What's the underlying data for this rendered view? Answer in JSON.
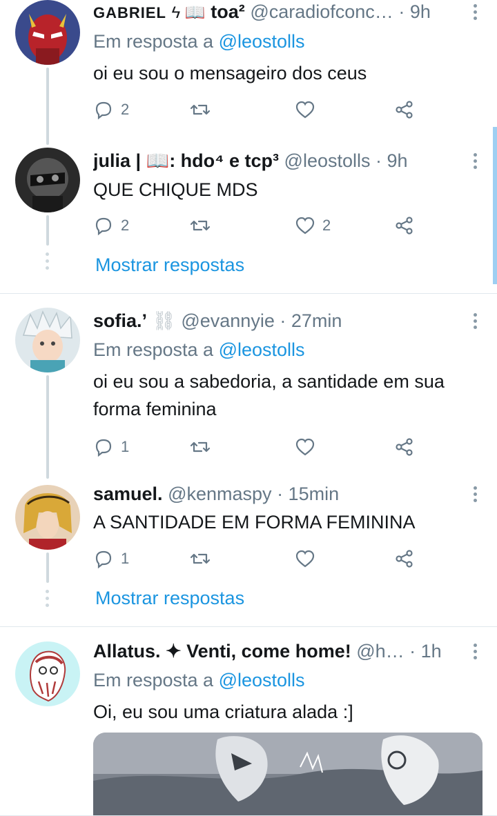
{
  "reply_prefix": "Em resposta a",
  "show_replies_label": "Mostrar respostas",
  "tweets": [
    {
      "name": "GABRIEL",
      "name_emoji": "ϟ 📖",
      "name_suffix": "toa²",
      "handle": "@caradiofconc…",
      "time": "· 9h",
      "reply_to": "@leostolls",
      "text": "oi eu sou o mensageiro dos ceus",
      "replies": "2",
      "retweets": "",
      "likes": ""
    },
    {
      "name": "julia | 📖: hdo⁴ e tcp³",
      "handle": "@leostolls",
      "time": "· 9h",
      "text": "QUE CHIQUE MDS",
      "replies": "2",
      "retweets": "",
      "likes": "2"
    },
    {
      "name": "sofia.’",
      "name_emoji": "⛓",
      "handle": "@evannyie",
      "time": "· 27min",
      "reply_to": "@leostolls",
      "text_line1": "oi eu sou a sabedoria, a santidade em sua",
      "text_line2": "forma feminina",
      "replies": "1",
      "retweets": "",
      "likes": ""
    },
    {
      "name": "samuel.",
      "handle": "@kenmaspy",
      "time": "· 15min",
      "text": "A SANTIDADE EM FORMA FEMININA",
      "replies": "1",
      "retweets": "",
      "likes": ""
    },
    {
      "name": "Allatus. ✦ Venti, come home!",
      "handle": "@h…",
      "time": "· 1h",
      "reply_to": "@leostolls",
      "text": "Oi, eu sou uma criatura alada :]"
    }
  ],
  "colors": {
    "link": "#1b95e0",
    "secondary_text": "#657786",
    "primary_text": "#14171a",
    "divider": "#e1e8ed",
    "thread_line": "#cfd9de",
    "scrollbar": "#9ecff2"
  },
  "icons": [
    "reply-icon",
    "retweet-icon",
    "like-icon",
    "share-icon",
    "more-icon"
  ]
}
